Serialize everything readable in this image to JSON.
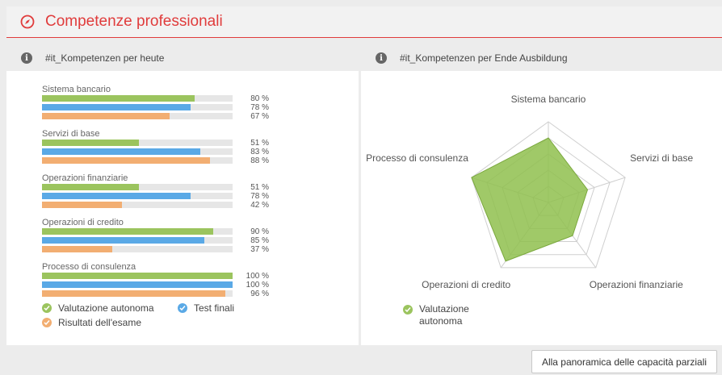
{
  "header": {
    "title": "Competenze professionali"
  },
  "left": {
    "title": "#it_Kompetenzen per heute",
    "categories": [
      {
        "label": "Sistema bancario",
        "values": [
          80,
          78,
          67
        ],
        "texts": [
          "80 %",
          "78 %",
          "67 %"
        ]
      },
      {
        "label": "Servizi di base",
        "values": [
          51,
          83,
          88
        ],
        "texts": [
          "51 %",
          "83 %",
          "88 %"
        ]
      },
      {
        "label": "Operazioni finanziarie",
        "values": [
          51,
          78,
          42
        ],
        "texts": [
          "51 %",
          "78 %",
          "42 %"
        ]
      },
      {
        "label": "Operazioni di credito",
        "values": [
          90,
          85,
          37
        ],
        "texts": [
          "90 %",
          "85 %",
          "37 %"
        ]
      },
      {
        "label": "Processo di consulenza",
        "values": [
          100,
          100,
          96
        ],
        "texts": [
          "100 %",
          "100 %",
          "96 %"
        ]
      }
    ],
    "legend": {
      "autonoma": "Valutazione autonoma",
      "test": "Test finali",
      "esame": "Risultati dell'esame"
    },
    "colors": {
      "autonoma": "#9bc45e",
      "test": "#5aa9e6",
      "esame": "#f2ae72",
      "track": "#e6e6e6"
    }
  },
  "right": {
    "title": "#it_Kompetenzen per Ende Ausbildung",
    "axes": [
      "Sistema bancario",
      "Servizi di base",
      "Operazioni finanziarie",
      "Operazioni di credito",
      "Processo di consulenza"
    ],
    "values": [
      80,
      51,
      51,
      90,
      100
    ],
    "legend": {
      "autonoma_line1": "Valutazione",
      "autonoma_line2": "autonoma"
    },
    "fill_color": "#8fbf4d"
  },
  "footer": {
    "button_label": "Alla panoramica delle capacità parziali"
  }
}
